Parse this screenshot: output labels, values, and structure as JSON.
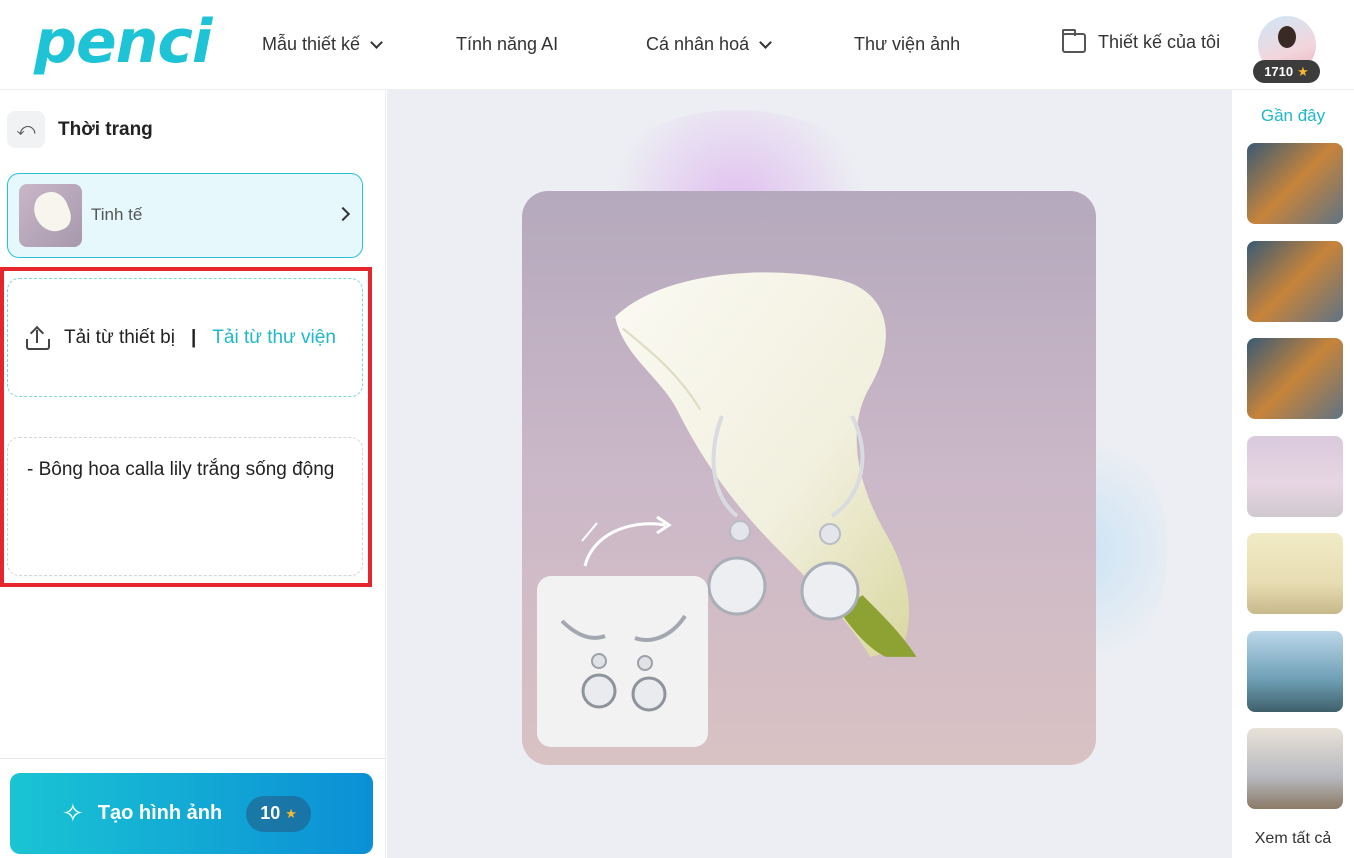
{
  "header": {
    "logo": "penci",
    "nav": [
      {
        "label": "Mẫu thiết kế",
        "has_dropdown": true
      },
      {
        "label": "Tính năng AI",
        "has_dropdown": false
      },
      {
        "label": "Cá nhân hoá",
        "has_dropdown": true
      },
      {
        "label": "Thư viện ảnh",
        "has_dropdown": false
      }
    ],
    "my_designs_label": "Thiết kế của tôi",
    "credits": "1710"
  },
  "left_panel": {
    "category_title": "Thời trang",
    "style": {
      "label": "Tinh tế"
    },
    "upload": {
      "from_device": "Tải từ thiết bị",
      "separator": "|",
      "from_library": "Tải từ thư viện"
    },
    "prompt_text": "- Bông hoa calla lily trắng sống động",
    "create_button": {
      "label": "Tạo hình ảnh",
      "cost": "10"
    }
  },
  "right_panel": {
    "title": "Gần đây",
    "see_all": "Xem tất cả",
    "thumbnails": [
      {
        "icon": "robot-juice-image"
      },
      {
        "icon": "robot-juice-image"
      },
      {
        "icon": "robot-juice-image"
      },
      {
        "icon": "matcha-lily-image"
      },
      {
        "icon": "matcha-drink-image"
      },
      {
        "icon": "matcha-sea-image"
      },
      {
        "icon": "laptop-image"
      }
    ]
  },
  "colors": {
    "accent": "#1fb8c8",
    "highlight": "#e5262d",
    "button_start": "#1ac4d3",
    "button_end": "#0b8fd6",
    "star": "#f5b82e"
  }
}
